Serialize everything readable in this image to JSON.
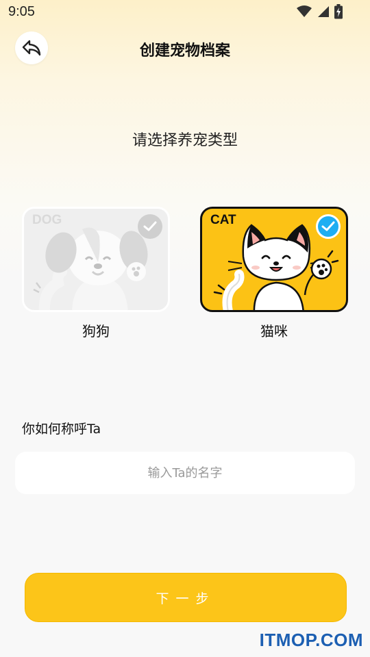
{
  "status_bar": {
    "time": "9:05",
    "icons": [
      "wifi-icon",
      "signal-icon",
      "battery-charging-icon"
    ]
  },
  "header": {
    "title": "创建宠物档案",
    "back_icon": "reply-arrow-icon"
  },
  "pet_type": {
    "prompt": "请选择养宠类型",
    "options": [
      {
        "tag": "DOG",
        "label": "狗狗",
        "selected": false
      },
      {
        "tag": "CAT",
        "label": "猫咪",
        "selected": true
      }
    ]
  },
  "name_field": {
    "question": "你如何称呼Ta",
    "value": "",
    "placeholder": "输入Ta的名字"
  },
  "next_button": {
    "label": "下一步"
  },
  "watermark": {
    "text": "ITMOP.COM"
  },
  "colors": {
    "accent": "#FCC519",
    "selected_check": "#1EAEF2",
    "card_selected_bg": "#FCC215",
    "card_unselected_bg": "#EFEFEF"
  }
}
